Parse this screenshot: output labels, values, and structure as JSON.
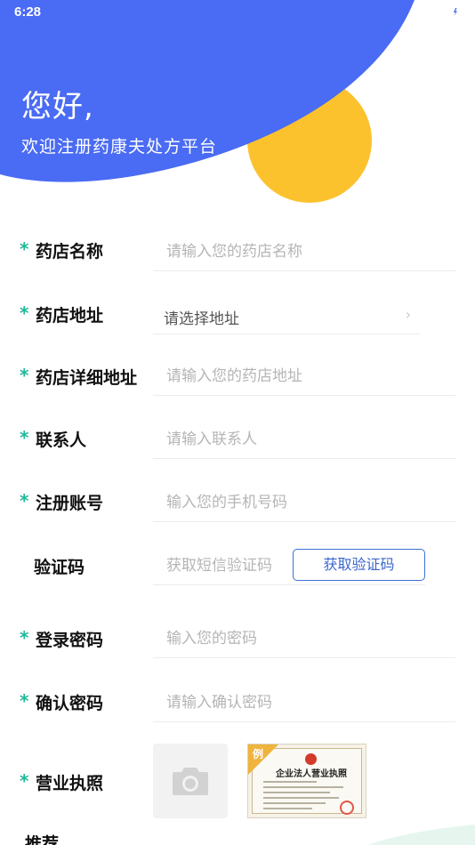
{
  "status_bar": {
    "time": "6:28",
    "icons": [
      "wifi-icon",
      "battery-icon"
    ]
  },
  "header": {
    "greeting": "您好,",
    "welcome": "欢迎注册药康夫处方平台",
    "colors": {
      "brand_blue": "#4a6bf3",
      "accent_yellow": "#fcc22e"
    }
  },
  "form": {
    "required_mark": "*",
    "pharmacy_name": {
      "label": "药店名称",
      "placeholder": "请输入您的药店名称"
    },
    "pharmacy_address": {
      "label": "药店地址",
      "value": "请选择地址",
      "chevron": "›"
    },
    "pharmacy_detail_address": {
      "label": "药店详细地址",
      "placeholder": "请输入您的药店地址"
    },
    "contact": {
      "label": "联系人",
      "placeholder": "请输入联系人"
    },
    "account": {
      "label": "注册账号",
      "placeholder": "输入您的手机号码"
    },
    "verify_code": {
      "label": "验证码",
      "placeholder": "获取短信验证码",
      "button": "获取验证码"
    },
    "password": {
      "label": "登录密码",
      "placeholder": "输入您的密码"
    },
    "confirm_password": {
      "label": "确认密码",
      "placeholder": "请输入确认密码"
    },
    "business_license": {
      "label": "营业执照",
      "upload_icon": "camera-icon",
      "sample_mark": "例",
      "sample_title": "企业法人营业执照"
    },
    "next_label_partial": "推荐"
  },
  "theme": {
    "star_color": "#20b89a",
    "button_border": "#3f6fd8"
  }
}
